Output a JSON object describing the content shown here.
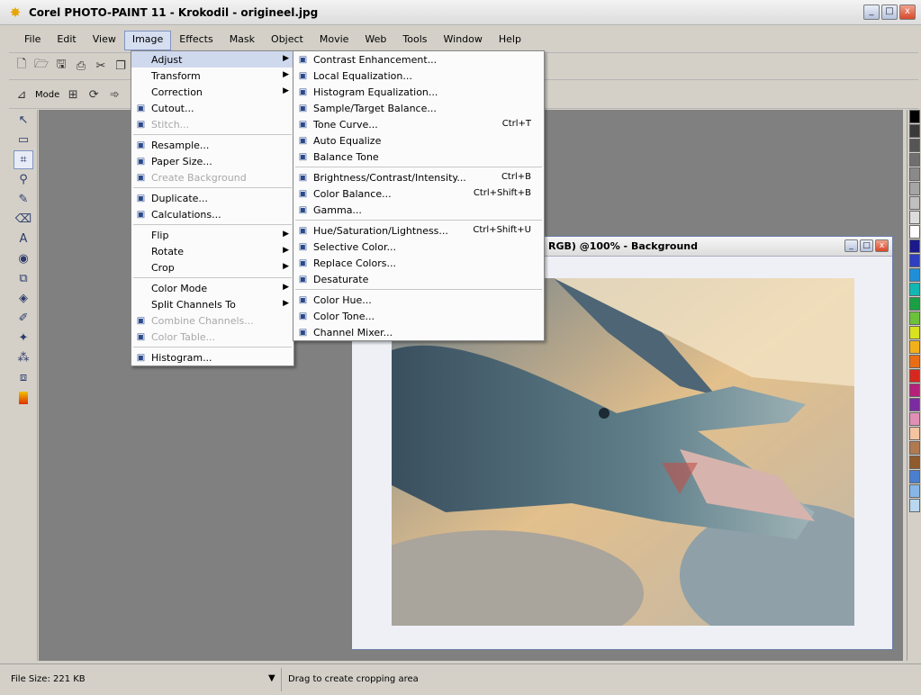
{
  "window": {
    "title": "Corel PHOTO-PAINT 11 - Krokodil - origineel.jpg",
    "buttons": [
      "_",
      "□",
      "x"
    ]
  },
  "menubar": [
    {
      "label": "File"
    },
    {
      "label": "Edit"
    },
    {
      "label": "View"
    },
    {
      "label": "Image"
    },
    {
      "label": "Effects"
    },
    {
      "label": "Mask"
    },
    {
      "label": "Object"
    },
    {
      "label": "Movie"
    },
    {
      "label": "Web"
    },
    {
      "label": "Tools"
    },
    {
      "label": "Window"
    },
    {
      "label": "Help"
    }
  ],
  "toolbar2": {
    "mode_label": "Mode"
  },
  "image_menu": [
    {
      "label": "Adjust",
      "submenu": true,
      "highlight": true
    },
    {
      "label": "Transform",
      "submenu": true
    },
    {
      "label": "Correction",
      "submenu": true
    },
    {
      "label": "Cutout...",
      "icon": "scissors-icon"
    },
    {
      "label": "Stitch...",
      "disabled": true,
      "icon": "stitch-icon"
    },
    {
      "sep": true
    },
    {
      "label": "Resample...",
      "icon": "resample-icon"
    },
    {
      "label": "Paper Size...",
      "icon": "paper-size-icon"
    },
    {
      "label": "Create Background",
      "disabled": true,
      "icon": "background-icon"
    },
    {
      "sep": true
    },
    {
      "label": "Duplicate...",
      "icon": "duplicate-icon"
    },
    {
      "label": "Calculations...",
      "icon": "calculations-icon"
    },
    {
      "sep": true
    },
    {
      "label": "Flip",
      "submenu": true
    },
    {
      "label": "Rotate",
      "submenu": true
    },
    {
      "label": "Crop",
      "submenu": true
    },
    {
      "sep": true
    },
    {
      "label": "Color Mode",
      "submenu": true
    },
    {
      "label": "Split Channels To",
      "submenu": true
    },
    {
      "label": "Combine Channels...",
      "disabled": true,
      "icon": "combine-channels-icon"
    },
    {
      "label": "Color Table...",
      "disabled": true,
      "icon": "color-table-icon"
    },
    {
      "sep": true
    },
    {
      "label": "Histogram...",
      "icon": "histogram-icon"
    }
  ],
  "adjust_menu": [
    {
      "label": "Contrast Enhancement...",
      "icon": "contrast-icon"
    },
    {
      "label": "Local Equalization...",
      "icon": "local-equalization-icon"
    },
    {
      "label": "Histogram Equalization...",
      "icon": "histogram-equalization-icon"
    },
    {
      "label": "Sample/Target Balance...",
      "icon": "sample-target-icon"
    },
    {
      "label": "Tone Curve...",
      "shortcut": "Ctrl+T",
      "icon": "tone-curve-icon"
    },
    {
      "label": "Auto Equalize",
      "icon": "auto-equalize-icon"
    },
    {
      "label": "Balance Tone",
      "icon": "balance-tone-icon"
    },
    {
      "sep": true
    },
    {
      "label": "Brightness/Contrast/Intensity...",
      "shortcut": "Ctrl+B",
      "icon": "brightness-icon"
    },
    {
      "label": "Color Balance...",
      "shortcut": "Ctrl+Shift+B",
      "icon": "color-balance-icon"
    },
    {
      "label": "Gamma...",
      "icon": "gamma-icon"
    },
    {
      "sep": true
    },
    {
      "label": "Hue/Saturation/Lightness...",
      "shortcut": "Ctrl+Shift+U",
      "icon": "hue-saturation-icon"
    },
    {
      "label": "Selective Color...",
      "icon": "selective-color-icon"
    },
    {
      "label": "Replace Colors...",
      "icon": "replace-colors-icon"
    },
    {
      "label": "Desaturate",
      "icon": "desaturate-icon"
    },
    {
      "sep": true
    },
    {
      "label": "Color Hue...",
      "icon": "color-hue-icon"
    },
    {
      "label": "Color Tone...",
      "icon": "color-tone-icon"
    },
    {
      "label": "Channel Mixer...",
      "icon": "channel-mixer-icon"
    }
  ],
  "document": {
    "title": "RGB) @100% - Background"
  },
  "status": {
    "file_size": "File Size: 221 KB",
    "hint": "Drag to create cropping area"
  },
  "palette_colors": [
    "#000000",
    "#3a3a3a",
    "#555555",
    "#6f6f6f",
    "#8a8a8a",
    "#a5a5a5",
    "#c0c0c0",
    "#dcdcdc",
    "#ffffff",
    "#1a1a8c",
    "#2f3fbf",
    "#1e8fd8",
    "#11b7b2",
    "#1aa043",
    "#6cc13a",
    "#d8e21e",
    "#f2b11b",
    "#ea6d14",
    "#d6281e",
    "#b4207a",
    "#7a2ca0",
    "#e18fb5",
    "#f4c3a0",
    "#b07950",
    "#8f5a2c",
    "#4a7fd0",
    "#86b6e8",
    "#b9d8ef"
  ]
}
